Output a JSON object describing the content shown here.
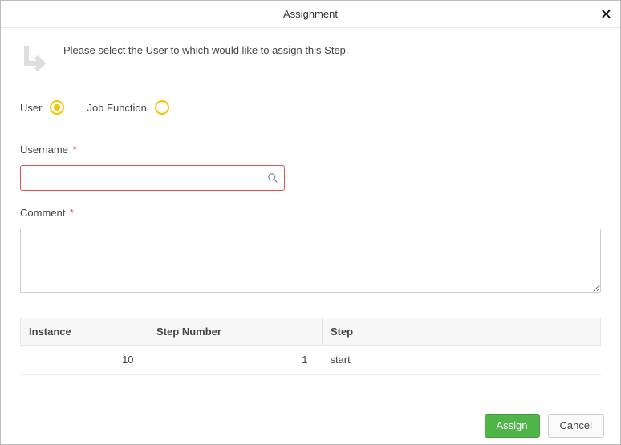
{
  "dialog": {
    "title": "Assignment",
    "close_glyph": "✕"
  },
  "intro": {
    "text": "Please select the User to which would like to assign this Step."
  },
  "radios": {
    "user_label": "User",
    "job_function_label": "Job Function",
    "selected": "user"
  },
  "fields": {
    "username_label": "Username",
    "username_value": "",
    "comment_label": "Comment",
    "comment_value": "",
    "required_mark": "*"
  },
  "table": {
    "headers": {
      "instance": "Instance",
      "step_number": "Step Number",
      "step": "Step"
    },
    "rows": [
      {
        "instance": "10",
        "step_number": "1",
        "step": "start"
      }
    ]
  },
  "footer": {
    "assign_label": "Assign",
    "cancel_label": "Cancel"
  }
}
